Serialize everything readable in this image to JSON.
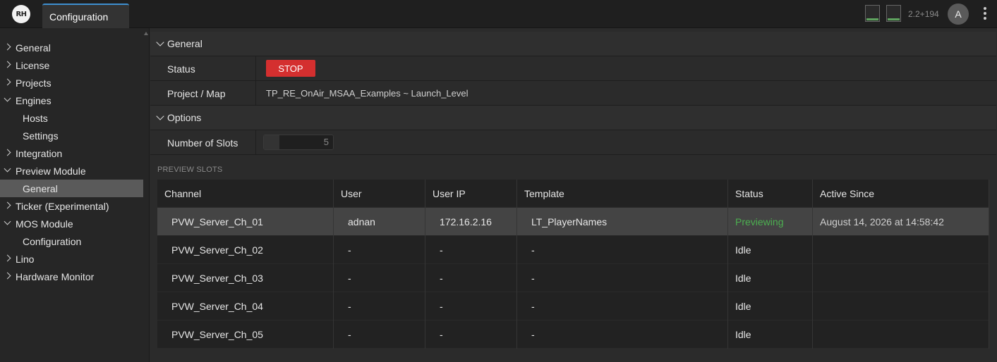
{
  "app": {
    "logo_text": "RH",
    "tab_label": "Configuration",
    "version": "2.2+194",
    "avatar_initial": "A"
  },
  "meters": [
    {
      "level": 0.15
    },
    {
      "level": 0.15
    }
  ],
  "sidebar": {
    "items": [
      {
        "label": "General",
        "expandable": true,
        "open": false
      },
      {
        "label": "License",
        "expandable": true,
        "open": false
      },
      {
        "label": "Projects",
        "expandable": true,
        "open": false
      },
      {
        "label": "Engines",
        "expandable": true,
        "open": true
      },
      {
        "label": "Hosts",
        "child": true
      },
      {
        "label": "Settings",
        "child": true
      },
      {
        "label": "Integration",
        "expandable": true,
        "open": false
      },
      {
        "label": "Preview Module",
        "expandable": true,
        "open": true
      },
      {
        "label": "General",
        "child": true,
        "selected": true
      },
      {
        "label": "Ticker (Experimental)",
        "expandable": true,
        "open": false
      },
      {
        "label": "MOS Module",
        "expandable": true,
        "open": true
      },
      {
        "label": "Configuration",
        "child": true
      },
      {
        "label": "Lino",
        "expandable": true,
        "open": false
      },
      {
        "label": "Hardware Monitor",
        "expandable": true,
        "open": false
      }
    ]
  },
  "general_section": {
    "title": "General",
    "status_label": "Status",
    "stop_label": "STOP",
    "project_label": "Project / Map",
    "project_value": "TP_RE_OnAir_MSAA_Examples ~ Launch_Level"
  },
  "options_section": {
    "title": "Options",
    "slots_label": "Number of Slots",
    "slots_value": "5"
  },
  "preview_slots": {
    "caption": "PREVIEW SLOTS",
    "columns": [
      "Channel",
      "User",
      "User IP",
      "Template",
      "Status",
      "Active Since"
    ],
    "rows": [
      {
        "channel": "PVW_Server_Ch_01",
        "user": "adnan",
        "ip": "172.16.2.16",
        "template": "LT_PlayerNames",
        "status": "Previewing",
        "since": "August 14, 2026 at 14:58:42",
        "active": true
      },
      {
        "channel": "PVW_Server_Ch_02",
        "user": "-",
        "ip": "-",
        "template": "-",
        "status": "Idle",
        "since": ""
      },
      {
        "channel": "PVW_Server_Ch_03",
        "user": "-",
        "ip": "-",
        "template": "-",
        "status": "Idle",
        "since": ""
      },
      {
        "channel": "PVW_Server_Ch_04",
        "user": "-",
        "ip": "-",
        "template": "-",
        "status": "Idle",
        "since": ""
      },
      {
        "channel": "PVW_Server_Ch_05",
        "user": "-",
        "ip": "-",
        "template": "-",
        "status": "Idle",
        "since": ""
      }
    ]
  },
  "colors": {
    "accent": "#3d8fd0",
    "stop": "#d42f2f",
    "previewing": "#4caf50",
    "selected": "#5a5a5a"
  }
}
